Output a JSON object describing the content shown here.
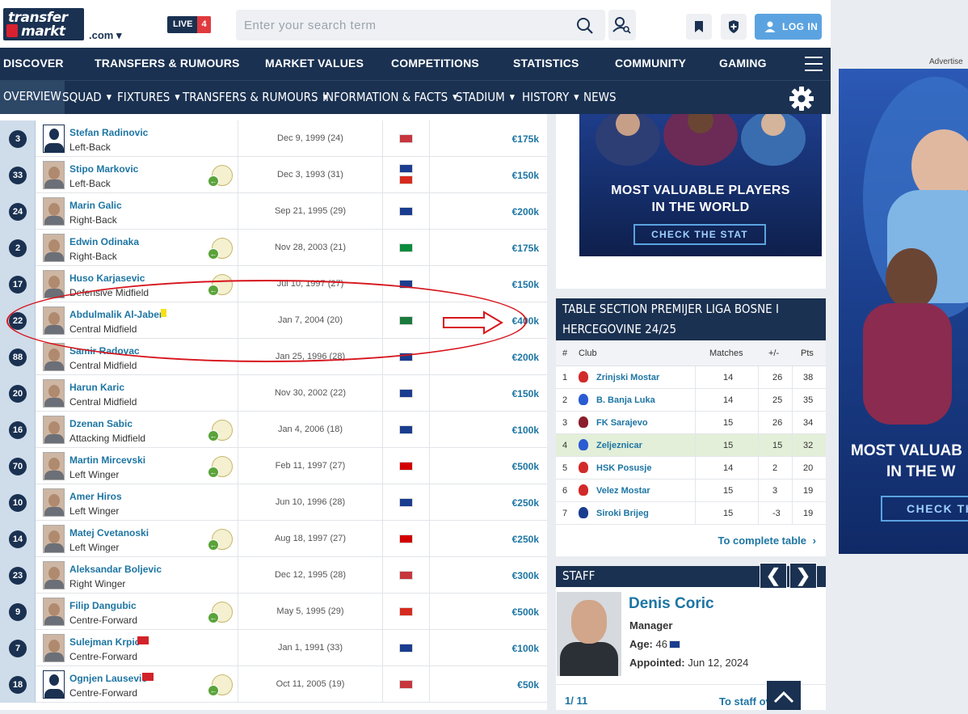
{
  "header": {
    "logo_line1": "transfer",
    "logo_line2": "markt",
    "domain": ".com ▾",
    "live_label": "LIVE",
    "live_count": "4",
    "search_placeholder": "Enter your search term",
    "login_label": "LOG IN"
  },
  "main_nav": [
    "DISCOVER",
    "TRANSFERS & RUMOURS",
    "MARKET VALUES",
    "COMPETITIONS",
    "STATISTICS",
    "COMMUNITY",
    "GAMING"
  ],
  "sub_nav": [
    {
      "label": "OVERVIEW",
      "caret": false,
      "active": true
    },
    {
      "label": "SQUAD",
      "caret": true
    },
    {
      "label": "FIXTURES",
      "caret": true
    },
    {
      "label": "TRANSFERS & RUMOURS",
      "caret": true
    },
    {
      "label": "INFORMATION & FACTS",
      "caret": true
    },
    {
      "label": "STADIUM",
      "caret": true
    },
    {
      "label": "HISTORY",
      "caret": true
    },
    {
      "label": "NEWS",
      "caret": false
    }
  ],
  "players": [
    {
      "num": "3",
      "name": "Stefan Radinovic",
      "pos": "Left-Back",
      "dob": "Dec 9, 1999 (24)",
      "value": "€175k",
      "silhouette": true,
      "badge": false,
      "flags": [
        "#c6363c"
      ]
    },
    {
      "num": "33",
      "name": "Stipo Markovic",
      "pos": "Left-Back",
      "dob": "Dec 3, 1993 (31)",
      "value": "€150k",
      "badge": true,
      "flags": [
        "#1a3d8f",
        "#d52b1e"
      ]
    },
    {
      "num": "24",
      "name": "Marin Galic",
      "pos": "Right-Back",
      "dob": "Sep 21, 1995 (29)",
      "value": "€200k",
      "badge": false,
      "flags": [
        "#1a3d8f"
      ]
    },
    {
      "num": "2",
      "name": "Edwin Odinaka",
      "pos": "Right-Back",
      "dob": "Nov 28, 2003 (21)",
      "value": "€175k",
      "badge": true,
      "flags": [
        "#0a8a3c"
      ]
    },
    {
      "num": "17",
      "name": "Huso Karjasevic",
      "pos": "Defensive Midfield",
      "dob": "Jul 10, 1997 (27)",
      "value": "€150k",
      "badge": true,
      "flags": [
        "#1a3d8f"
      ]
    },
    {
      "num": "22",
      "name": "Abdulmalik Al-Jaber",
      "pos": "Central Midfield",
      "dob": "Jan 7, 2004 (20)",
      "value": "€400k",
      "badge": false,
      "flags": [
        "#1b7a3d"
      ],
      "yellow": true
    },
    {
      "num": "88",
      "name": "Samir Radovac",
      "pos": "Central Midfield",
      "dob": "Jan 25, 1996 (28)",
      "value": "€200k",
      "badge": false,
      "flags": [
        "#1a3d8f"
      ]
    },
    {
      "num": "20",
      "name": "Harun Karic",
      "pos": "Central Midfield",
      "dob": "Nov 30, 2002 (22)",
      "value": "€150k",
      "badge": false,
      "flags": [
        "#1a3d8f"
      ]
    },
    {
      "num": "16",
      "name": "Dzenan Sabic",
      "pos": "Attacking Midfield",
      "dob": "Jan 4, 2006 (18)",
      "value": "€100k",
      "badge": true,
      "flags": [
        "#1a3d8f"
      ]
    },
    {
      "num": "70",
      "name": "Martin Mircevski",
      "pos": "Left Winger",
      "dob": "Feb 11, 1997 (27)",
      "value": "€500k",
      "badge": true,
      "flags": [
        "#d20000"
      ]
    },
    {
      "num": "10",
      "name": "Amer Hiros",
      "pos": "Left Winger",
      "dob": "Jun 10, 1996 (28)",
      "value": "€250k",
      "badge": false,
      "flags": [
        "#1a3d8f"
      ]
    },
    {
      "num": "14",
      "name": "Matej Cvetanoski",
      "pos": "Left Winger",
      "dob": "Aug 18, 1997 (27)",
      "value": "€250k",
      "badge": true,
      "flags": [
        "#d20000"
      ]
    },
    {
      "num": "23",
      "name": "Aleksandar Boljevic",
      "pos": "Right Winger",
      "dob": "Dec 12, 1995 (28)",
      "value": "€300k",
      "badge": false,
      "flags": [
        "#c6363c"
      ]
    },
    {
      "num": "9",
      "name": "Filip Dangubic",
      "pos": "Centre-Forward",
      "dob": "May 5, 1995 (29)",
      "value": "€500k",
      "badge": true,
      "flags": [
        "#d52b1e"
      ]
    },
    {
      "num": "7",
      "name": "Sulejman Krpic",
      "pos": "Centre-Forward",
      "dob": "Jan 1, 1991 (33)",
      "value": "€100k",
      "badge": false,
      "flags": [
        "#1a3d8f"
      ],
      "miniflag": true
    },
    {
      "num": "18",
      "name": "Ognjen Lausevic",
      "pos": "Centre-Forward",
      "dob": "Oct 11, 2005 (19)",
      "value": "€50k",
      "silhouette": true,
      "badge": true,
      "flags": [
        "#c6363c"
      ],
      "miniflag": true
    }
  ],
  "promo": {
    "title_line1": "MOST VALUABLE PLAYERS",
    "title_line2": "IN THE WORLD",
    "button": "CHECK THE STAT"
  },
  "league_table": {
    "title": "TABLE SECTION PREMIJER LIGA BOSNE I HERCEGOVINE 24/25",
    "columns": [
      "#",
      "Club",
      "Matches",
      "+/-",
      "Pts"
    ],
    "rows": [
      {
        "pos": "1",
        "club": "Zrinjski Mostar",
        "matches": "14",
        "diff": "26",
        "pts": "38",
        "crest": "#d22a2a"
      },
      {
        "pos": "2",
        "club": "B. Banja Luka",
        "matches": "14",
        "diff": "25",
        "pts": "35",
        "crest": "#2a5bd2"
      },
      {
        "pos": "3",
        "club": "FK Sarajevo",
        "matches": "15",
        "diff": "26",
        "pts": "34",
        "crest": "#8a1e2c"
      },
      {
        "pos": "4",
        "club": "Zeljeznicar",
        "matches": "15",
        "diff": "15",
        "pts": "32",
        "crest": "#2a5bd2",
        "highlight": true
      },
      {
        "pos": "5",
        "club": "HSK Posusje",
        "matches": "14",
        "diff": "2",
        "pts": "20",
        "crest": "#d22a2a"
      },
      {
        "pos": "6",
        "club": "Velez Mostar",
        "matches": "15",
        "diff": "3",
        "pts": "19",
        "crest": "#d22a2a"
      },
      {
        "pos": "7",
        "club": "Siroki Brijeg",
        "matches": "15",
        "diff": "-3",
        "pts": "19",
        "crest": "#1a3d8f"
      }
    ],
    "footer": "To complete table"
  },
  "staff": {
    "title": "STAFF",
    "prev": "❮",
    "next": "❯",
    "name": "Denis Coric",
    "role": "Manager",
    "age_label": "Age:",
    "age": "46",
    "appointed_label": "Appointed:",
    "appointed": "Jun 12, 2024",
    "pager": "1/ 11",
    "footer": "To staff ov"
  },
  "ad": {
    "label": "Advertise",
    "title_line1": "MOST VALUAB",
    "title_line2": "IN THE W",
    "button": "CHECK TH"
  },
  "colors": {
    "navy": "#1a3151",
    "link": "#1d75a3",
    "annotation": "#d7151d"
  }
}
